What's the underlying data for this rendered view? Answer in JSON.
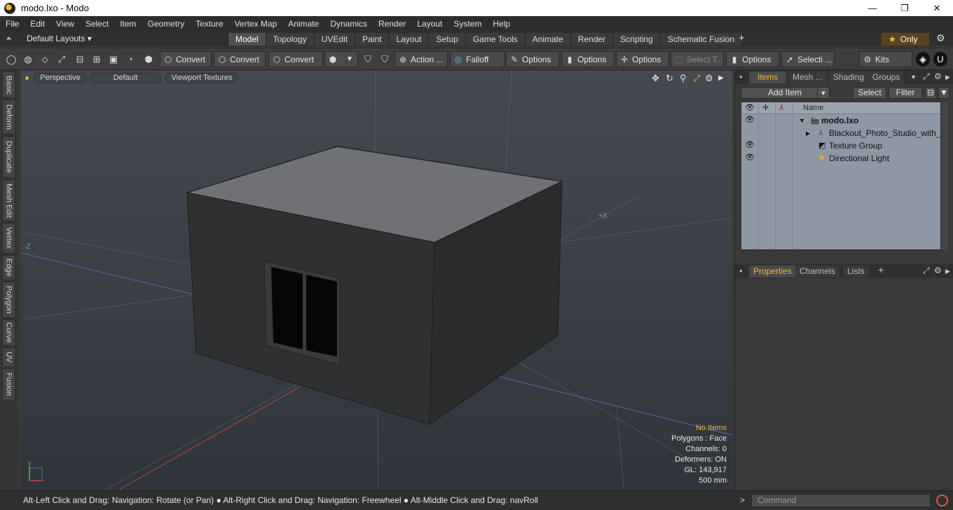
{
  "window": {
    "title": "modo.lxo - Modo",
    "minimize": "—",
    "maximize": "❐",
    "close": "✕"
  },
  "menu": [
    "File",
    "Edit",
    "View",
    "Select",
    "Item",
    "Geometry",
    "Texture",
    "Vertex Map",
    "Animate",
    "Dynamics",
    "Render",
    "Layout",
    "System",
    "Help"
  ],
  "layoutbar": {
    "layouts_label": "Default Layouts ▾",
    "tabs": [
      "Model",
      "Topology",
      "UVEdit",
      "Paint",
      "Layout",
      "Setup",
      "Game Tools",
      "Animate",
      "Render",
      "Scripting",
      "Schematic Fusion"
    ],
    "active_tab": "Model",
    "only_label": "Only"
  },
  "toolbar": {
    "convert1": "Convert",
    "convert2": "Convert",
    "convert3": "Convert",
    "action": "Action ...",
    "falloff": "Falloff",
    "options1": "Options",
    "options2": "Options",
    "options3": "Options",
    "select_t": "Select T...",
    "options4": "Options",
    "selecti": "Selecti ...",
    "kits": "Kits"
  },
  "left_tabs": [
    "Basic",
    "Deform",
    "Duplicate",
    "Mesh Edit",
    "Vertex",
    "Edge",
    "Polygon",
    "Curve",
    "UV",
    "Fusion"
  ],
  "viewport": {
    "view": "Perspective",
    "shading": "Default",
    "textures": "Viewport Textures",
    "axis_x": "+X",
    "axis_z": "-Z",
    "info": {
      "items": "No Items",
      "polygons": "Polygons : Face",
      "channels": "Channels: 0",
      "deformers": "Deformers: ON",
      "gl": "GL: 143,917",
      "unit": "500 mm"
    }
  },
  "status": {
    "message": "Alt-Left Click and Drag: Navigation: Rotate (or Pan) ● Alt-Right Click and Drag: Navigation: Freewheel ● Alt-Middle Click and Drag: navRoll"
  },
  "items_panel": {
    "tabs": [
      "Items",
      "Mesh ...",
      "Shading",
      "Groups"
    ],
    "active_tab": "Items",
    "add_item": "Add Item",
    "select": "Select",
    "filter": "Filter",
    "column_name": "Name",
    "rows": [
      {
        "name": "modo.lxo",
        "icon": "scene-icon"
      },
      {
        "name": "Blackout_Photo_Studio_with_ ...",
        "icon": "locator-icon"
      },
      {
        "name": "Texture Group",
        "icon": "texture-group-icon"
      },
      {
        "name": "Directional Light",
        "icon": "light-icon"
      }
    ]
  },
  "properties_panel": {
    "tabs": [
      "Properties",
      "Channels",
      "Lists"
    ],
    "active_tab": "Properties"
  },
  "command": {
    "placeholder": "Command"
  },
  "colors": {
    "accent": "#f0b640",
    "items_bg": "#8e98a4"
  }
}
